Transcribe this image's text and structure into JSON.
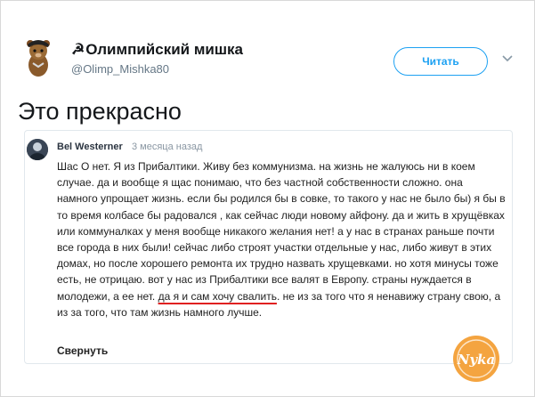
{
  "tweet": {
    "display_name_symbol": "☭",
    "display_name": "Олимпийский мишка",
    "handle": "@Olimp_Mishka80",
    "read_button": "Читать",
    "text": "Это прекрасно"
  },
  "comment": {
    "author": "Bel Westerner",
    "time": "3 месяца назад",
    "body_before": "Шас О нет. Я из Прибалтики. Живу без коммунизма. на жизнь не жалуюсь ни в коем случае. да и вообще я щас понимаю, что без частной собственности сложно. она намного упрощает жизнь. если бы родился бы в совке, то такого у нас не было бы) я бы в то время колбасе бы радовался , как сейчас люди новому айфону. да и жить в хрущёвках или коммуналках у меня вообще никакого желания нет! а у нас в странах раньше почти все города в них были! сейчас либо строят участки отдельные у нас, либо живут в этих домах, но после хорошего ремонта их трудно назвать хрущевками. но хотя минусы тоже есть, не отрицаю. вот у нас из Прибалтики все валят в Европу. страны нуждается в молодежи, а ее нет. ",
    "body_highlight": "да я и сам хочу свалить",
    "body_after": ". не из за того что я ненавижу страну свою, а из за того, что там жизнь намного лучше.",
    "collapse": "Свернуть"
  },
  "watermark": {
    "text": "Nyka"
  },
  "colors": {
    "accent": "#1da1f2",
    "underline": "#e02020",
    "watermark": "#f39a2b"
  }
}
